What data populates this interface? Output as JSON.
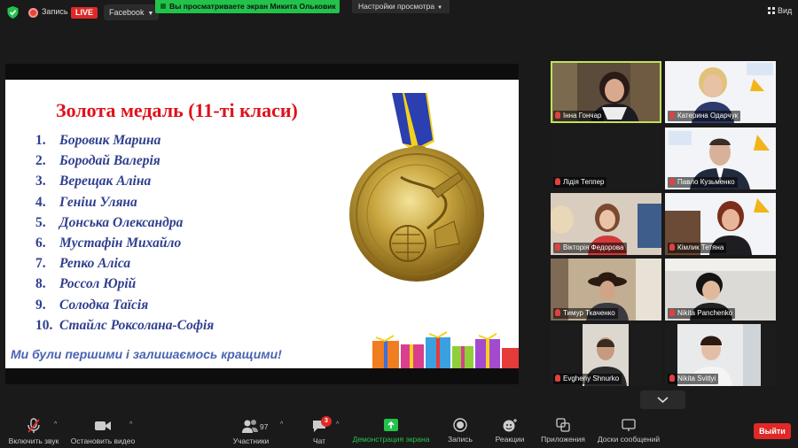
{
  "topbar": {
    "record_label": "Запись",
    "live_label": "LIVE",
    "facebook_label": "Facebook",
    "share_banner": "Вы просматриваете экран Микита Ольковик",
    "view_settings": "Настройки просмотра",
    "view_label": "Вид"
  },
  "slide": {
    "title": "Золота медаль (11-ті  класи)",
    "names": [
      {
        "num": "1.",
        "name": "Боровик Марина"
      },
      {
        "num": "2.",
        "name": "Бородай Валерія"
      },
      {
        "num": "3.",
        "name": "Верещак Аліна"
      },
      {
        "num": "4.",
        "name": "Геніш Уляна"
      },
      {
        "num": "5.",
        "name": "Донська Олександра"
      },
      {
        "num": "6.",
        "name": "Мустафін Михайло"
      },
      {
        "num": "7.",
        "name": "Репко Аліса"
      },
      {
        "num": "8.",
        "name": "Россол Юрій"
      },
      {
        "num": "9.",
        "name": "Солодка Таїсія"
      },
      {
        "num": "10.",
        "name": "Стайлс Роксолана-Софія"
      }
    ],
    "motto": "Ми були першими і залишаємось кращими!"
  },
  "participants": [
    {
      "name": "Інна Гончар"
    },
    {
      "name": "Катерина Одарчук"
    },
    {
      "name": "Лідія Теппер"
    },
    {
      "name": "Павло Кузьменко"
    },
    {
      "name": "Вікторія Федорова"
    },
    {
      "name": "Кімлик Тетяна"
    },
    {
      "name": "Тимур Ткаченко"
    },
    {
      "name": "Nikita Panchenko"
    },
    {
      "name": "Evgheny Shnurko"
    },
    {
      "name": "Nikita Svitlyi"
    }
  ],
  "toolbar": {
    "unmute": "Включить звук",
    "stop_video": "Остановить видео",
    "participants": "Участники",
    "participants_count": "97",
    "chat": "Чат",
    "chat_badge": "3",
    "share_screen": "Демонстрация экрана",
    "record": "Запись",
    "reactions": "Реакции",
    "apps": "Приложения",
    "whiteboards": "Доски сообщений",
    "leave": "Выйти"
  },
  "colors": {
    "share_green": "#23c24b",
    "leave_red": "#e02828",
    "title_red": "#e0101a",
    "names_blue": "#2f3f8e",
    "active_speaker": "#c4e05a"
  }
}
